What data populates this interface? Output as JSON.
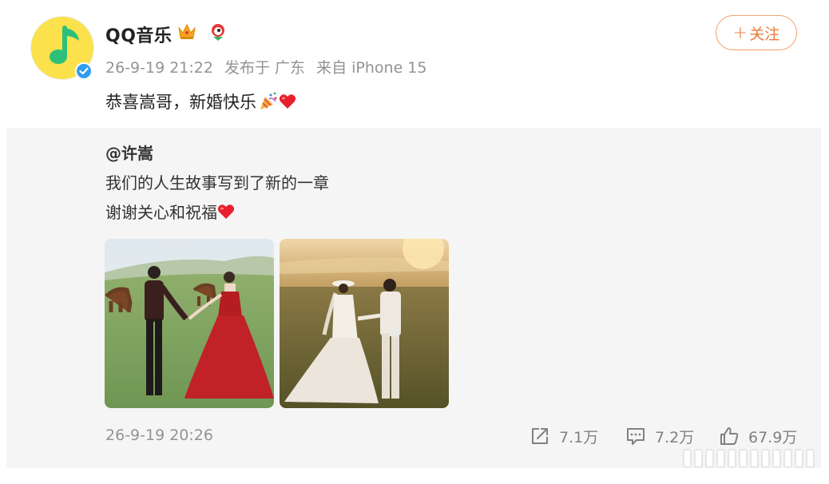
{
  "post": {
    "author": "QQ音乐",
    "badges": [
      "crown-icon",
      "bird-icon"
    ],
    "date": "26-9-19 21:22",
    "location": "发布于 广东",
    "source": "来自 iPhone 15",
    "follow_label": "关注",
    "follow_plus": "+",
    "text": "恭喜嵩哥，新婚快乐"
  },
  "repost": {
    "user": "@许嵩",
    "line1": "我们的人生故事写到了新的一章",
    "line2": "谢谢关心和祝福",
    "time": "26-9-19 20:26"
  },
  "actions": {
    "share_count": "7.1万",
    "comment_count": "7.2万",
    "like_count": "67.9万"
  },
  "colors": {
    "accent": "#ee7a38",
    "verified": "#2f9cf0",
    "muted": "#939393",
    "repost_bg": "#f5f5f5"
  }
}
